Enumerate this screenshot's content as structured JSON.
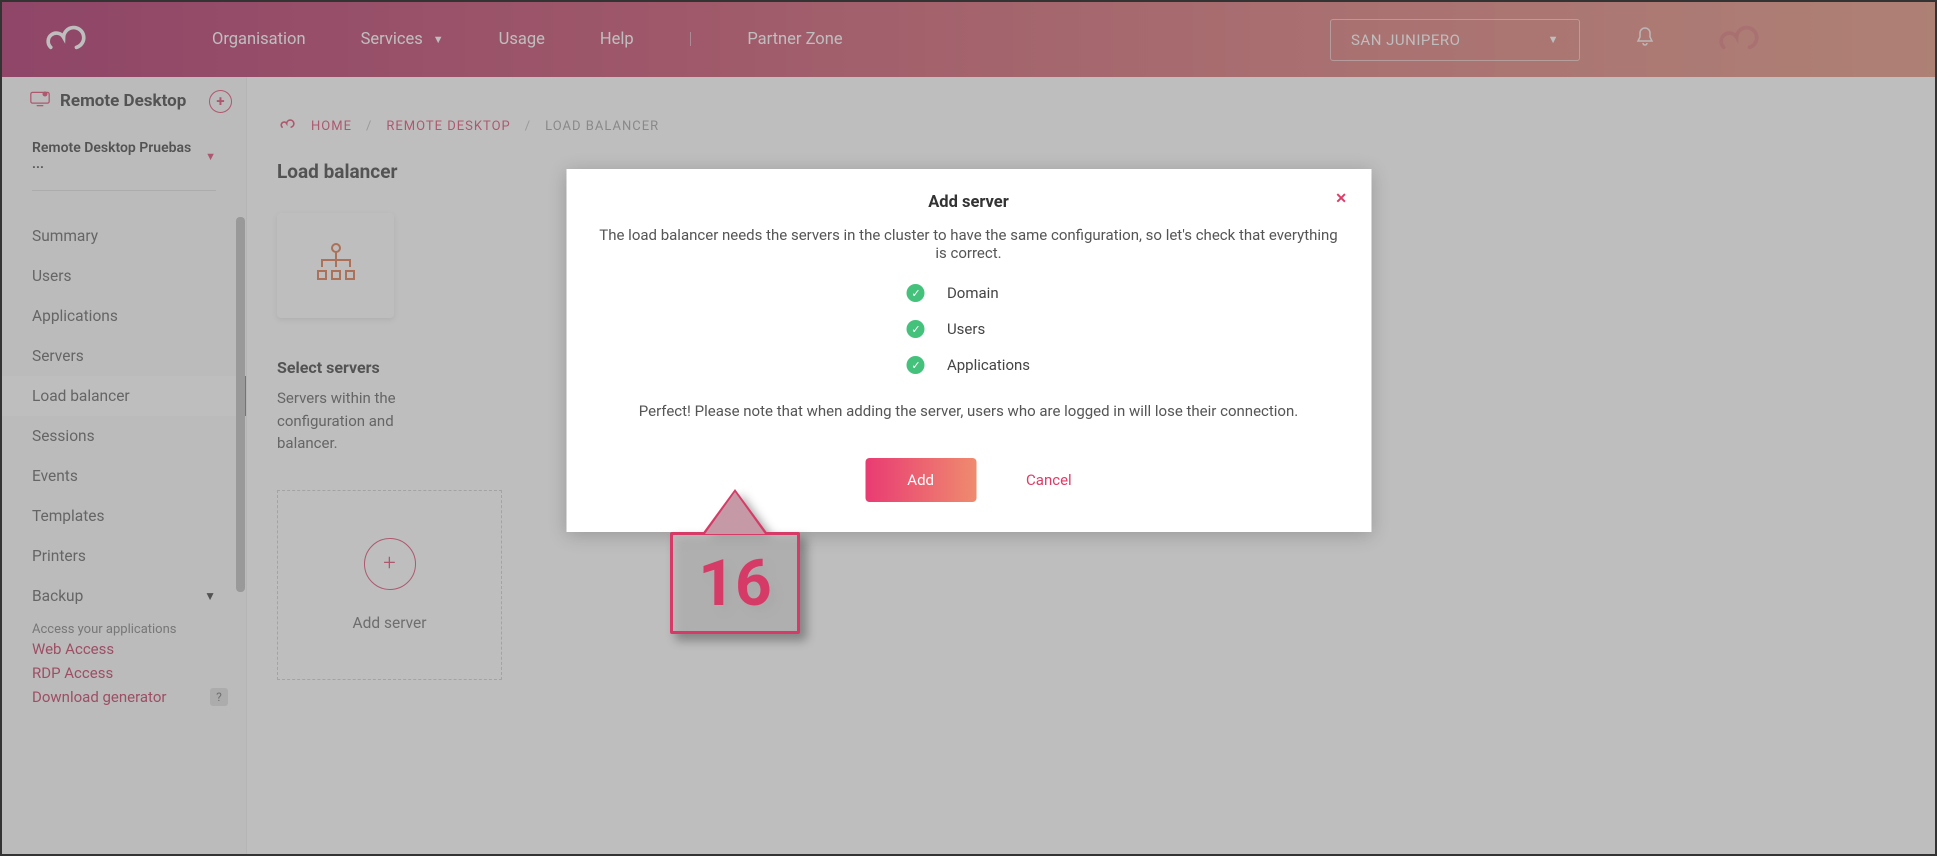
{
  "header": {
    "nav": {
      "organisation": "Organisation",
      "services": "Services",
      "usage": "Usage",
      "help": "Help",
      "partner": "Partner Zone"
    },
    "org_selected": "SAN JUNIPERO"
  },
  "sidebar": {
    "title": "Remote Desktop",
    "project": "Remote Desktop Pruebas ...",
    "items": [
      {
        "label": "Summary"
      },
      {
        "label": "Users"
      },
      {
        "label": "Applications"
      },
      {
        "label": "Servers"
      },
      {
        "label": "Load balancer"
      },
      {
        "label": "Sessions"
      },
      {
        "label": "Events"
      },
      {
        "label": "Templates"
      },
      {
        "label": "Printers"
      },
      {
        "label": "Backup"
      }
    ],
    "footer_title": "Access your applications",
    "links": {
      "web": "Web Access",
      "rdp": "RDP Access",
      "download": "Download generator"
    },
    "help_badge": "?"
  },
  "breadcrumb": {
    "home": "HOME",
    "section": "REMOTE DESKTOP",
    "current": "LOAD BALANCER"
  },
  "page": {
    "title": "Load balancer",
    "section_title": "Select servers",
    "section_desc_partial": "Servers within the configuration and balancer.",
    "add_server_label": "Add server"
  },
  "modal": {
    "title": "Add server",
    "subtitle": "The load balancer needs the servers in the cluster to have the same configuration, so let's check that everything is correct.",
    "checks": [
      {
        "label": "Domain"
      },
      {
        "label": "Users"
      },
      {
        "label": "Applications"
      }
    ],
    "note": "Perfect! Please note that when adding the server, users who are logged in will lose their connection.",
    "add_btn": "Add",
    "cancel_btn": "Cancel",
    "close": "✕"
  },
  "callout": {
    "number": "16"
  }
}
